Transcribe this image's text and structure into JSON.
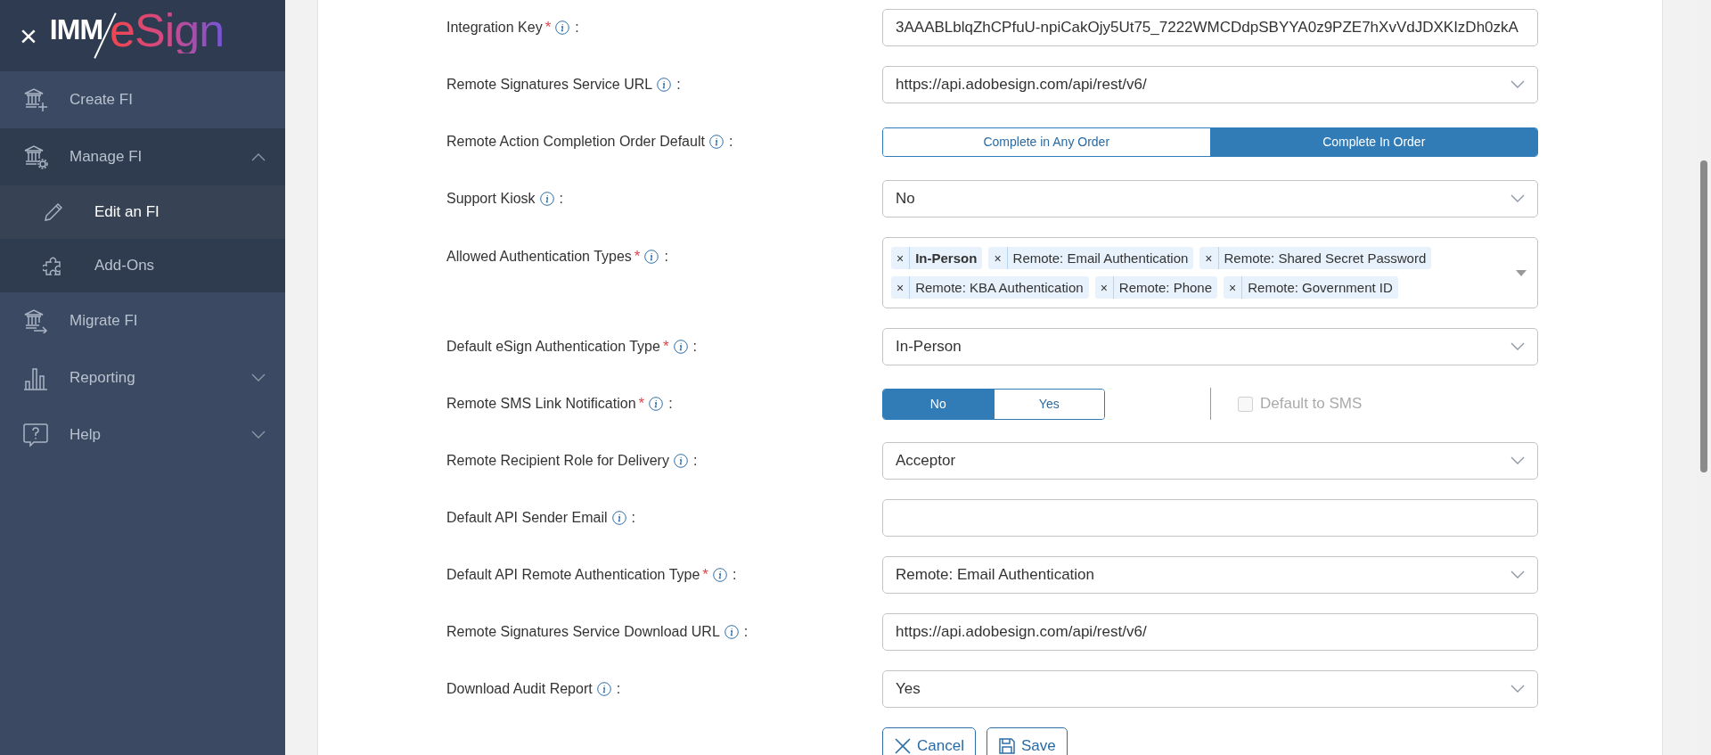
{
  "sidebar": {
    "close": "×",
    "logo": {
      "prefix": "IMM",
      "suffix": "eSign"
    },
    "items": [
      {
        "label": "Create FI",
        "selected": false,
        "expandable": false,
        "expanded": false
      },
      {
        "label": "Manage FI",
        "selected": false,
        "expandable": true,
        "expanded": true,
        "children": [
          {
            "label": "Edit an FI",
            "selected": true
          },
          {
            "label": "Add-Ons",
            "selected": false
          }
        ]
      },
      {
        "label": "Migrate FI",
        "selected": false,
        "expandable": false,
        "expanded": false
      },
      {
        "label": "Reporting",
        "selected": false,
        "expandable": true,
        "expanded": false
      },
      {
        "label": "Help",
        "selected": false,
        "expandable": true,
        "expanded": false
      }
    ]
  },
  "form": {
    "rows": [
      {
        "kind": "text",
        "label": "Integration Key",
        "required": true,
        "value": "3AAABLblqZhCPfuU-npiCakOjy5Ut75_7222WMCDdpSBYYA0z9PZE7hXvVdJDXKIzDh0zkA"
      },
      {
        "kind": "select",
        "label": "Remote Signatures Service URL",
        "required": false,
        "value": "https://api.adobesign.com/api/rest/v6/"
      },
      {
        "kind": "segmented",
        "label": "Remote Action Completion Order Default",
        "required": false,
        "options": [
          {
            "label": "Complete in Any Order",
            "selected": false
          },
          {
            "label": "Complete In Order",
            "selected": true
          }
        ]
      },
      {
        "kind": "select",
        "label": "Support Kiosk",
        "required": false,
        "value": "No"
      },
      {
        "kind": "tags",
        "label": "Allowed Authentication Types",
        "required": true,
        "tags": [
          {
            "label": "In-Person",
            "bold": true
          },
          {
            "label": "Remote: Email Authentication",
            "bold": false
          },
          {
            "label": "Remote: Shared Secret Password",
            "bold": false
          },
          {
            "label": "Remote: KBA Authentication",
            "bold": false
          },
          {
            "label": "Remote: Phone",
            "bold": false
          },
          {
            "label": "Remote: Government ID",
            "bold": false
          }
        ],
        "remove": "×"
      },
      {
        "kind": "select",
        "label": "Default eSign Authentication Type",
        "required": true,
        "value": "In-Person"
      },
      {
        "kind": "segmented",
        "label": "Remote SMS Link Notification",
        "required": true,
        "options": [
          {
            "label": "No",
            "selected": true
          },
          {
            "label": "Yes",
            "selected": false
          }
        ],
        "checkbox": {
          "label": "Default to SMS",
          "checked": false,
          "disabled": true
        }
      },
      {
        "kind": "select",
        "label": "Remote Recipient Role for Delivery",
        "required": false,
        "value": "Acceptor"
      },
      {
        "kind": "text",
        "label": "Default API Sender Email",
        "required": false
      },
      {
        "kind": "select",
        "label": "Default API Remote Authentication Type",
        "required": true,
        "value": "Remote: Email Authentication"
      },
      {
        "kind": "text",
        "label": "Remote Signatures Service Download URL",
        "required": false,
        "value": "https://api.adobesign.com/api/rest/v6/"
      },
      {
        "kind": "select",
        "label": "Download Audit Report",
        "required": false,
        "value": "Yes"
      }
    ],
    "buttons": [
      {
        "kind": "cancel",
        "label": "Cancel"
      },
      {
        "kind": "save",
        "label": "Save"
      }
    ],
    "colon": ":",
    "required_mark": "*"
  }
}
